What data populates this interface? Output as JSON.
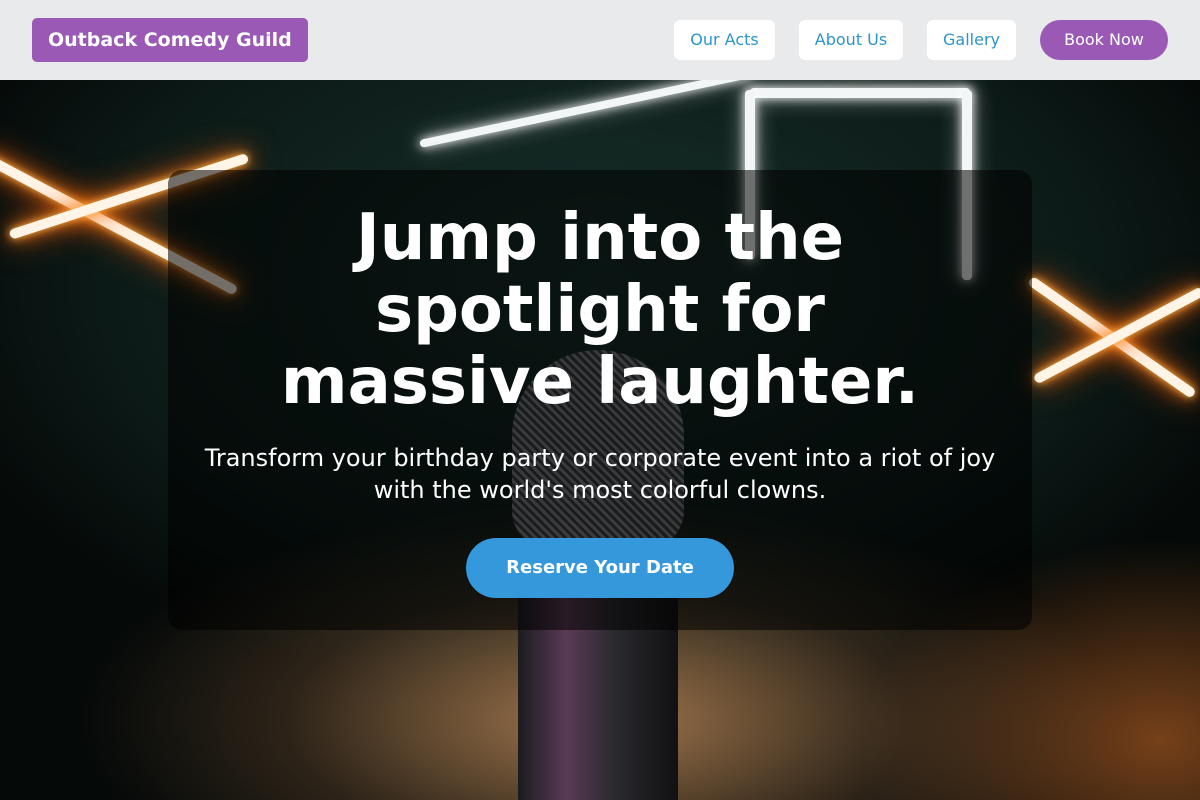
{
  "header": {
    "logo": "Outback Comedy Guild",
    "nav": [
      {
        "label": "Our Acts"
      },
      {
        "label": "About Us"
      },
      {
        "label": "Gallery"
      }
    ],
    "book_button": "Book Now"
  },
  "hero": {
    "headline": "Jump into the spotlight for massive laughter.",
    "subtitle": "Transform your birthday party or corporate event into a riot of joy with the world's most colorful clowns.",
    "cta": "Reserve Your Date"
  },
  "colors": {
    "brand_purple": "#9b59b6",
    "cta_blue": "#3498db",
    "nav_link": "#2d95c9",
    "header_bg": "#e9eaeb"
  }
}
